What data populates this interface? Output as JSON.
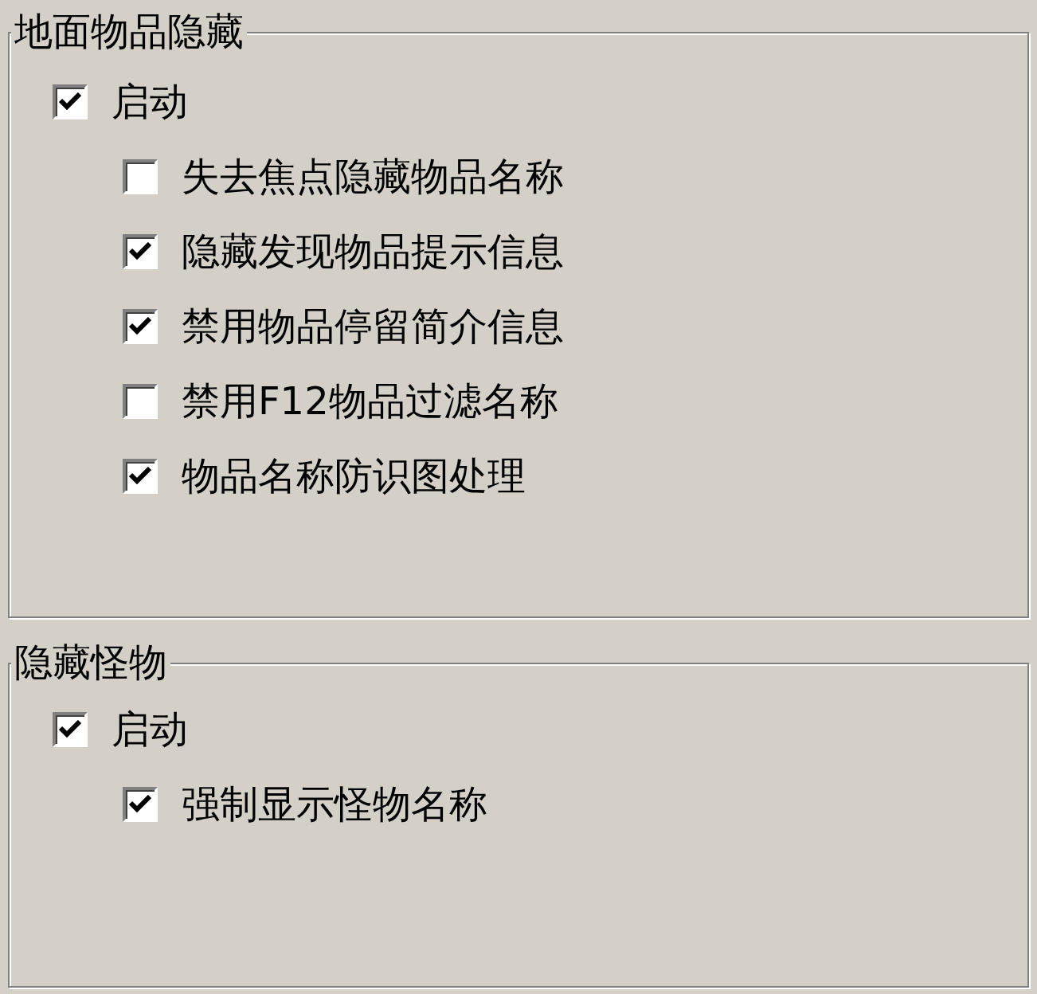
{
  "groups": [
    {
      "title": "地面物品隐藏",
      "items": [
        {
          "label": "启动",
          "checked": true,
          "children": [
            {
              "label": "失去焦点隐藏物品名称",
              "checked": false
            },
            {
              "label": "隐藏发现物品提示信息",
              "checked": true
            },
            {
              "label": "禁用物品停留简介信息",
              "checked": true
            },
            {
              "label": "禁用F12物品过滤名称",
              "checked": false
            },
            {
              "label": "物品名称防识图处理",
              "checked": true
            }
          ]
        }
      ]
    },
    {
      "title": "隐藏怪物",
      "items": [
        {
          "label": "启动",
          "checked": true,
          "children": [
            {
              "label": "强制显示怪物名称",
              "checked": true
            }
          ]
        }
      ]
    }
  ]
}
